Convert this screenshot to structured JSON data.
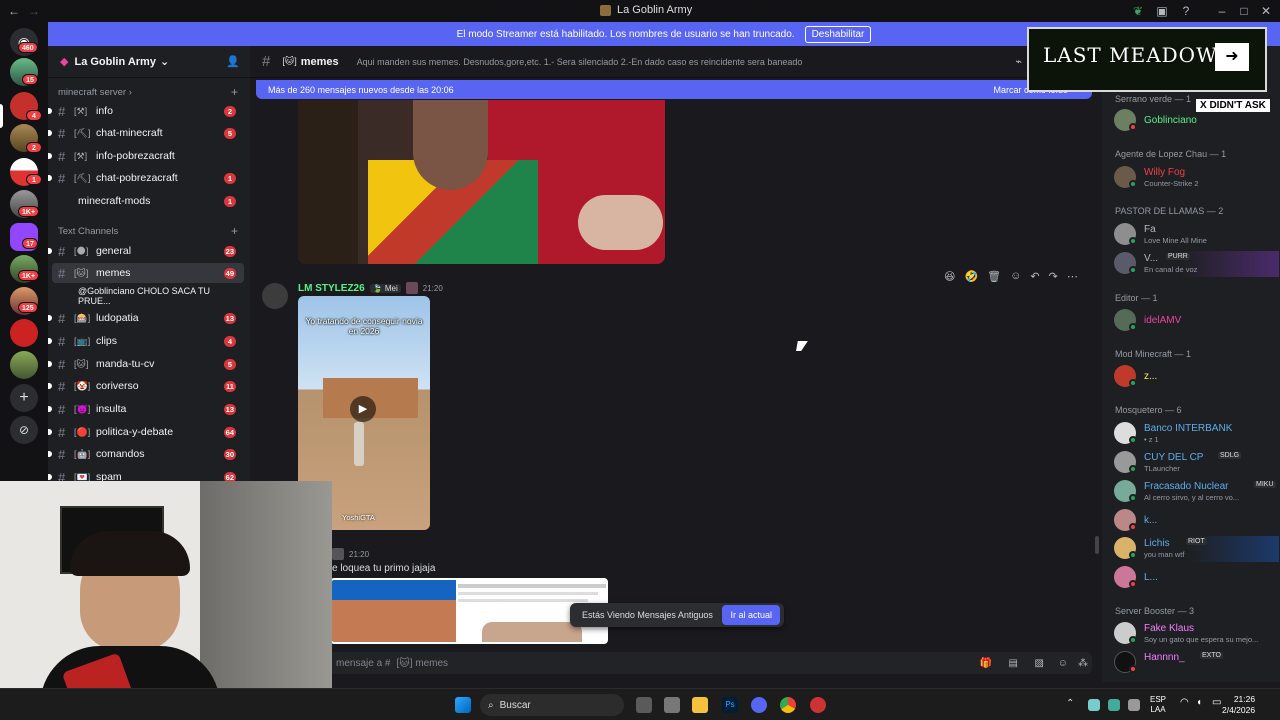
{
  "window": {
    "title": "La Goblin Army",
    "controls": [
      "minimize",
      "maximize",
      "close"
    ]
  },
  "banner": {
    "text": "El modo Streamer está habilitado. Los nombres de usuario se han truncado.",
    "button": "Deshabilitar"
  },
  "rail": {
    "badges": [
      "460",
      "15",
      "4",
      "2",
      "1",
      "1K+",
      "17",
      "1K+",
      "125"
    ]
  },
  "guild": {
    "name": "La Goblin Army"
  },
  "sidebar": {
    "cat_minecraft": "minecraft server",
    "cat_text": "Text Channels",
    "channels": [
      {
        "emoji": "[⚒]",
        "name": "info",
        "badge": "2"
      },
      {
        "emoji": "[⛏]",
        "name": "chat-minecraft",
        "badge": "5"
      },
      {
        "emoji": "[⚒]",
        "name": "info-pobrezacraft",
        "badge": ""
      },
      {
        "emoji": "[⛏]",
        "name": "chat-pobrezacraft",
        "badge": "1"
      },
      {
        "emoji": "",
        "name": "minecraft-mods",
        "badge": "1"
      },
      {
        "emoji": "[🌑]",
        "name": "general",
        "badge": "23"
      },
      {
        "emoji": "[🐱]",
        "name": "memes",
        "badge": "49"
      },
      {
        "emoji": "",
        "name": "@Goblinciano CHOLO SACA TU PRUE...",
        "badge": ""
      },
      {
        "emoji": "[🎰]",
        "name": "ludopatia",
        "badge": "13"
      },
      {
        "emoji": "[📺]",
        "name": "clips",
        "badge": "4"
      },
      {
        "emoji": "[🐱]",
        "name": "manda-tu-cv",
        "badge": "5"
      },
      {
        "emoji": "[🤡]",
        "name": "coriverso",
        "badge": "11"
      },
      {
        "emoji": "[👿]",
        "name": "insulta",
        "badge": "13"
      },
      {
        "emoji": "[🔴]",
        "name": "politica-y-debate",
        "badge": "64"
      },
      {
        "emoji": "[🤖]",
        "name": "comandos",
        "badge": "30"
      },
      {
        "emoji": "[💌]",
        "name": "spam",
        "badge": "62"
      }
    ]
  },
  "chat": {
    "channel_emoji": "[🐱]",
    "channel_name": "memes",
    "topic": "Aqui manden sus memes. Desnudos,gore,etc. 1.- Sera silenciado 2.-En dado caso es reincidente sera baneado",
    "new_messages": "Más de 260 mensajes nuevos desde las 20:06",
    "mark_read": "Marcar como leído",
    "msg1": {
      "author": "LM STYLEZ26",
      "tag": "Mei",
      "time": "21:20",
      "video_caption": "Yo tratando de conseguir novia en 2026",
      "video_watermark": "YoshiGTA"
    },
    "msg2": {
      "time": "21:20",
      "text": "e loquea tu primo jajaja"
    },
    "jump_text": "Estás Viendo Mensajes Antiguos",
    "jump_button": "Ir al actual",
    "composer_placeholder": "mensaje a #",
    "composer_channel": "[🐱] memes"
  },
  "ad": {
    "title": "LAST MEADOW",
    "tag": "X DIDN'T ASK"
  },
  "members": {
    "roles": [
      {
        "label": "Serrano verde — 1"
      },
      {
        "label": "Agente de Lopez Chau — 1"
      },
      {
        "label": "PASTOR DE LLAMAS — 2"
      },
      {
        "label": "Editor — 1"
      },
      {
        "label": "Mod Minecraft — 1"
      },
      {
        "label": "Mosquetero — 6"
      },
      {
        "label": "Server Booster — 3"
      }
    ],
    "list": [
      {
        "name": "Goblinciano",
        "status": "",
        "color": "#57f287"
      },
      {
        "name": "Willy Fog",
        "status": "Counter-Strike 2",
        "color": "#ed4245"
      },
      {
        "name": "Fa",
        "status": "Love Mine All Mine",
        "color": "#b5bac1"
      },
      {
        "name": "V...",
        "status": "En canal de voz",
        "color": "#b5bac1"
      },
      {
        "name": "idelAMV",
        "status": "",
        "color": "#eb459e"
      },
      {
        "name": "z...",
        "status": "",
        "color": "#fee75c"
      },
      {
        "name": "Banco INTERBANK",
        "status": "• z 1",
        "color": "#5dadec"
      },
      {
        "name": "CUY DEL CP",
        "status": "TLauncher",
        "color": "#5dadec"
      },
      {
        "name": "Fracasado Nuclear",
        "status": "Al cerro sirvo, y al cerro vo...",
        "color": "#5dadec"
      },
      {
        "name": "k...",
        "status": "",
        "color": "#5dadec"
      },
      {
        "name": "Lichis",
        "status": "you man wtf",
        "color": "#5dadec"
      },
      {
        "name": "L...",
        "status": "",
        "color": "#5dadec"
      },
      {
        "name": "Fake Klaus",
        "status": "Soy un gato que espera su mejo...",
        "color": "#f47fff"
      },
      {
        "name": "Hannnn_",
        "status": "",
        "color": "#f47fff"
      }
    ],
    "tags": {
      "purr": "PURR",
      "sdlg": "SDLG",
      "miku": "MIKU",
      "riot": "RIOT",
      "exto": "EXTO"
    }
  },
  "taskbar": {
    "search": "Buscar",
    "lang": "ESP",
    "lang2": "LAA",
    "time": "21:26",
    "date": "2/4/2026"
  }
}
